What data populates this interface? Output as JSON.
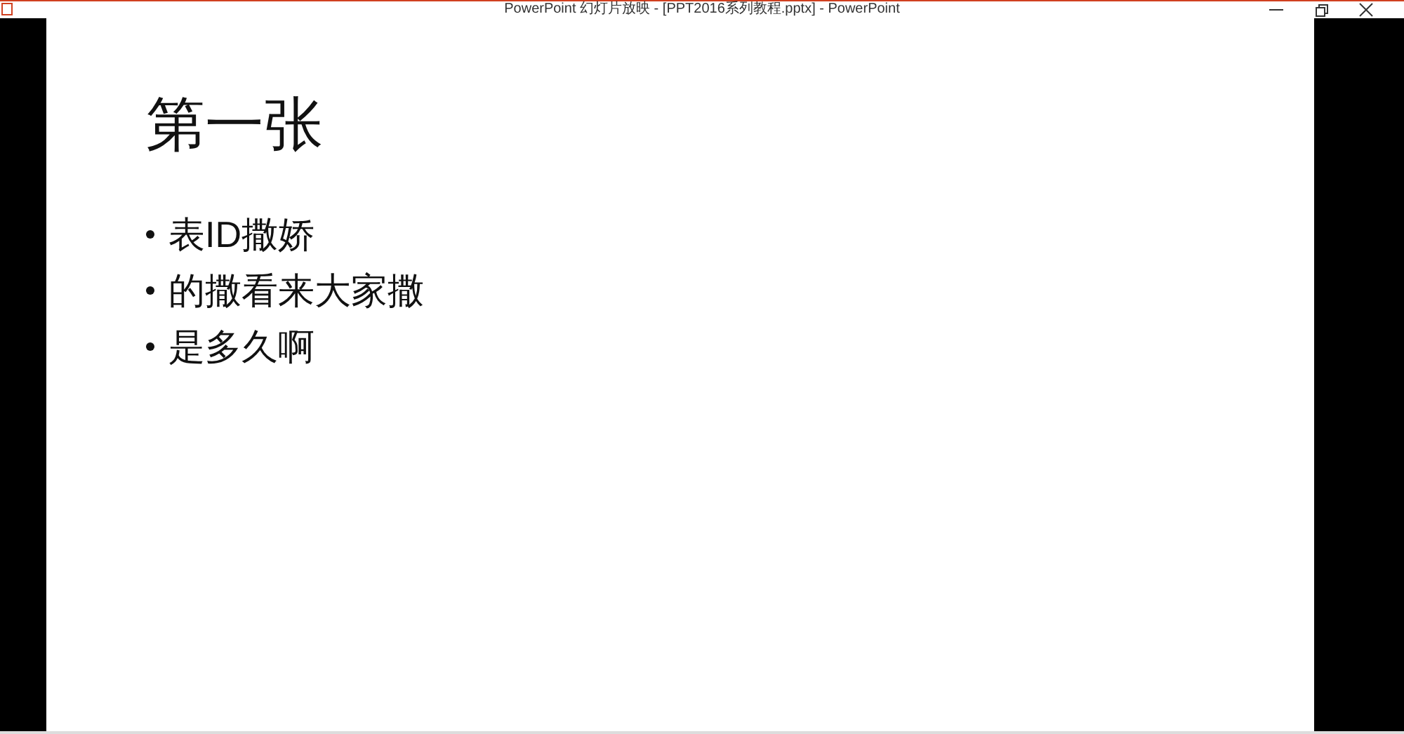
{
  "window": {
    "title": "PowerPoint 幻灯片放映 - [PPT2016系列教程.pptx] - PowerPoint"
  },
  "slide": {
    "title": "第一张",
    "bullets": [
      "表ID撒娇",
      "的撒看来大家撒",
      "是多久啊"
    ]
  }
}
